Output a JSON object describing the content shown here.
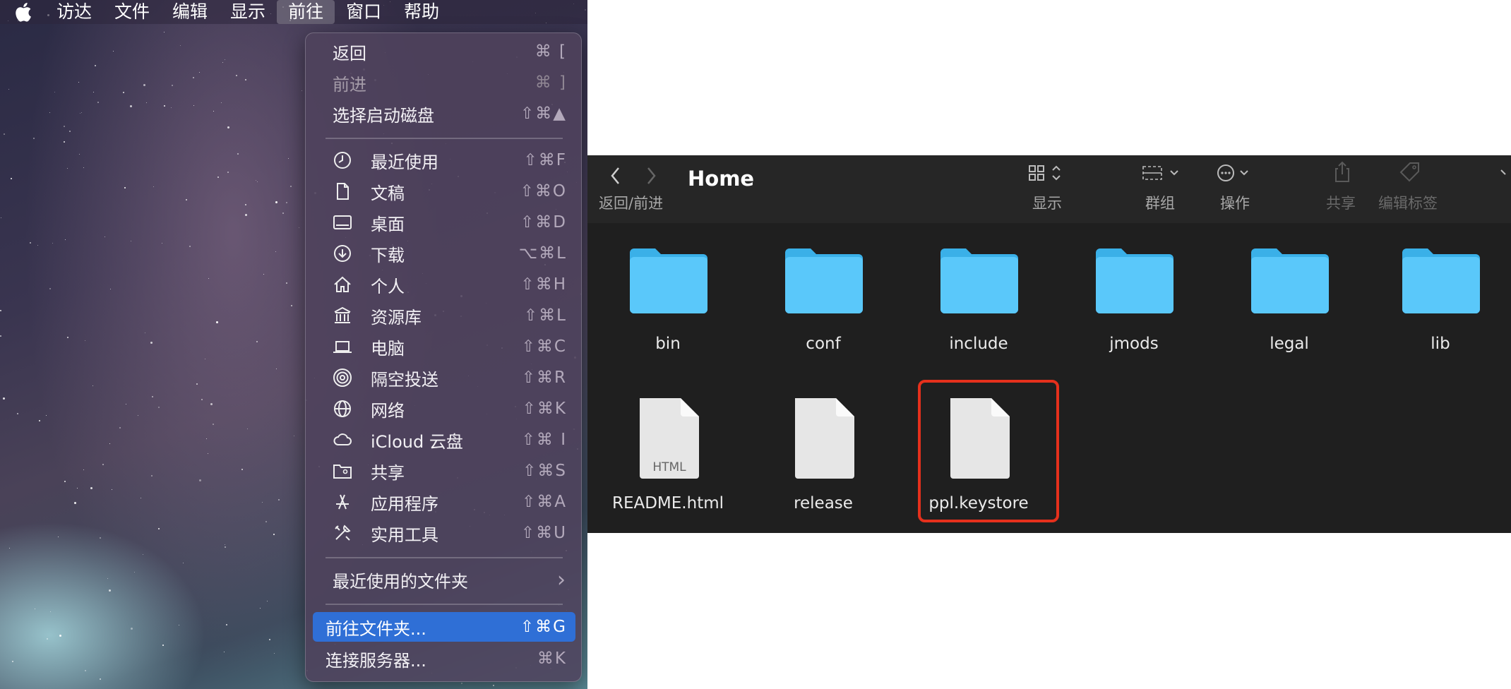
{
  "menubar": {
    "items": [
      "访达",
      "文件",
      "编辑",
      "显示",
      "前往",
      "窗口",
      "帮助"
    ],
    "active": "前往"
  },
  "go_menu": {
    "top_items": [
      {
        "label": "返回",
        "shortcut": "⌘ [",
        "enabled": true
      },
      {
        "label": "前进",
        "shortcut": "⌘ ]",
        "enabled": false
      },
      {
        "label": "选择启动磁盘",
        "shortcut": "⇧⌘▲",
        "enabled": true
      }
    ],
    "places": [
      {
        "label": "最近使用",
        "shortcut": "⇧⌘F",
        "icon": "clock-icon"
      },
      {
        "label": "文稿",
        "shortcut": "⇧⌘O",
        "icon": "document-icon"
      },
      {
        "label": "桌面",
        "shortcut": "⇧⌘D",
        "icon": "desktop-icon"
      },
      {
        "label": "下载",
        "shortcut": "⌥⌘L",
        "icon": "download-icon"
      },
      {
        "label": "个人",
        "shortcut": "⇧⌘H",
        "icon": "home-icon"
      },
      {
        "label": "资源库",
        "shortcut": "⇧⌘L",
        "icon": "library-icon"
      },
      {
        "label": "电脑",
        "shortcut": "⇧⌘C",
        "icon": "laptop-icon"
      },
      {
        "label": "隔空投送",
        "shortcut": "⇧⌘R",
        "icon": "airdrop-icon"
      },
      {
        "label": "网络",
        "shortcut": "⇧⌘K",
        "icon": "network-icon"
      },
      {
        "label": "iCloud 云盘",
        "shortcut": "⇧⌘ I",
        "icon": "cloud-icon"
      },
      {
        "label": "共享",
        "shortcut": "⇧⌘S",
        "icon": "shared-folder-icon"
      },
      {
        "label": "应用程序",
        "shortcut": "⇧⌘A",
        "icon": "applications-icon"
      },
      {
        "label": "实用工具",
        "shortcut": "⇧⌘U",
        "icon": "utilities-icon"
      }
    ],
    "recent_folders": {
      "label": "最近使用的文件夹",
      "arrow": "›"
    },
    "bottom_items": [
      {
        "label": "前往文件夹...",
        "shortcut": "⇧⌘G",
        "highlighted": true
      },
      {
        "label": "连接服务器...",
        "shortcut": "⌘K",
        "highlighted": false
      }
    ]
  },
  "finder": {
    "title": "Home",
    "toolbar": {
      "back_forward_label": "返回/前进",
      "view_label": "显示",
      "group_label": "群组",
      "action_label": "操作",
      "share_label": "共享",
      "tags_label": "编辑标签"
    },
    "folders": [
      "bin",
      "conf",
      "include",
      "jmods",
      "legal",
      "lib"
    ],
    "files": [
      {
        "name": "README.html",
        "badge": "HTML"
      },
      {
        "name": "release",
        "badge": ""
      },
      {
        "name": "ppl.keystore",
        "badge": ""
      }
    ],
    "highlighted_file": "ppl.keystore",
    "highlight_color": "#e5301c",
    "folder_color": "#4cc3f5"
  }
}
